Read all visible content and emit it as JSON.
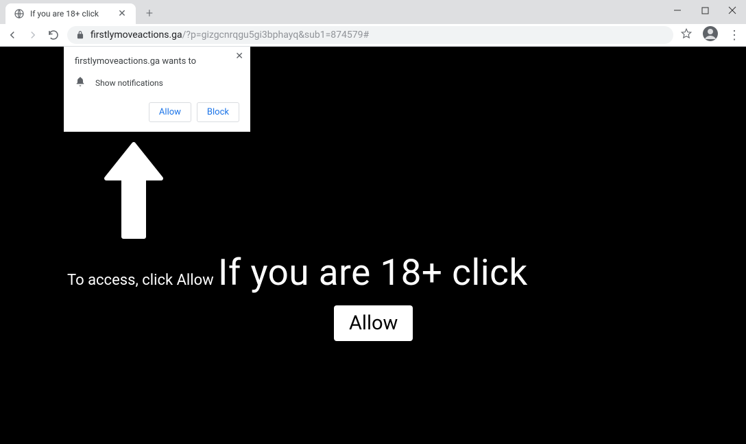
{
  "window": {
    "minimize": "—",
    "maximize": "□",
    "close": "✕"
  },
  "tab": {
    "title": "If you are 18+ click"
  },
  "url": {
    "host": "firstlymoveactions.ga",
    "path": "/?p=gizgcnrqgu5gi3bphayq&sub1=874579#"
  },
  "notification": {
    "header": "firstlymoveactions.ga wants to",
    "text": "Show notifications",
    "allow": "Allow",
    "block": "Block"
  },
  "page": {
    "access_text": "To access, click Allow",
    "main_text": "If you are 18+ click",
    "allow_button": "Allow"
  }
}
